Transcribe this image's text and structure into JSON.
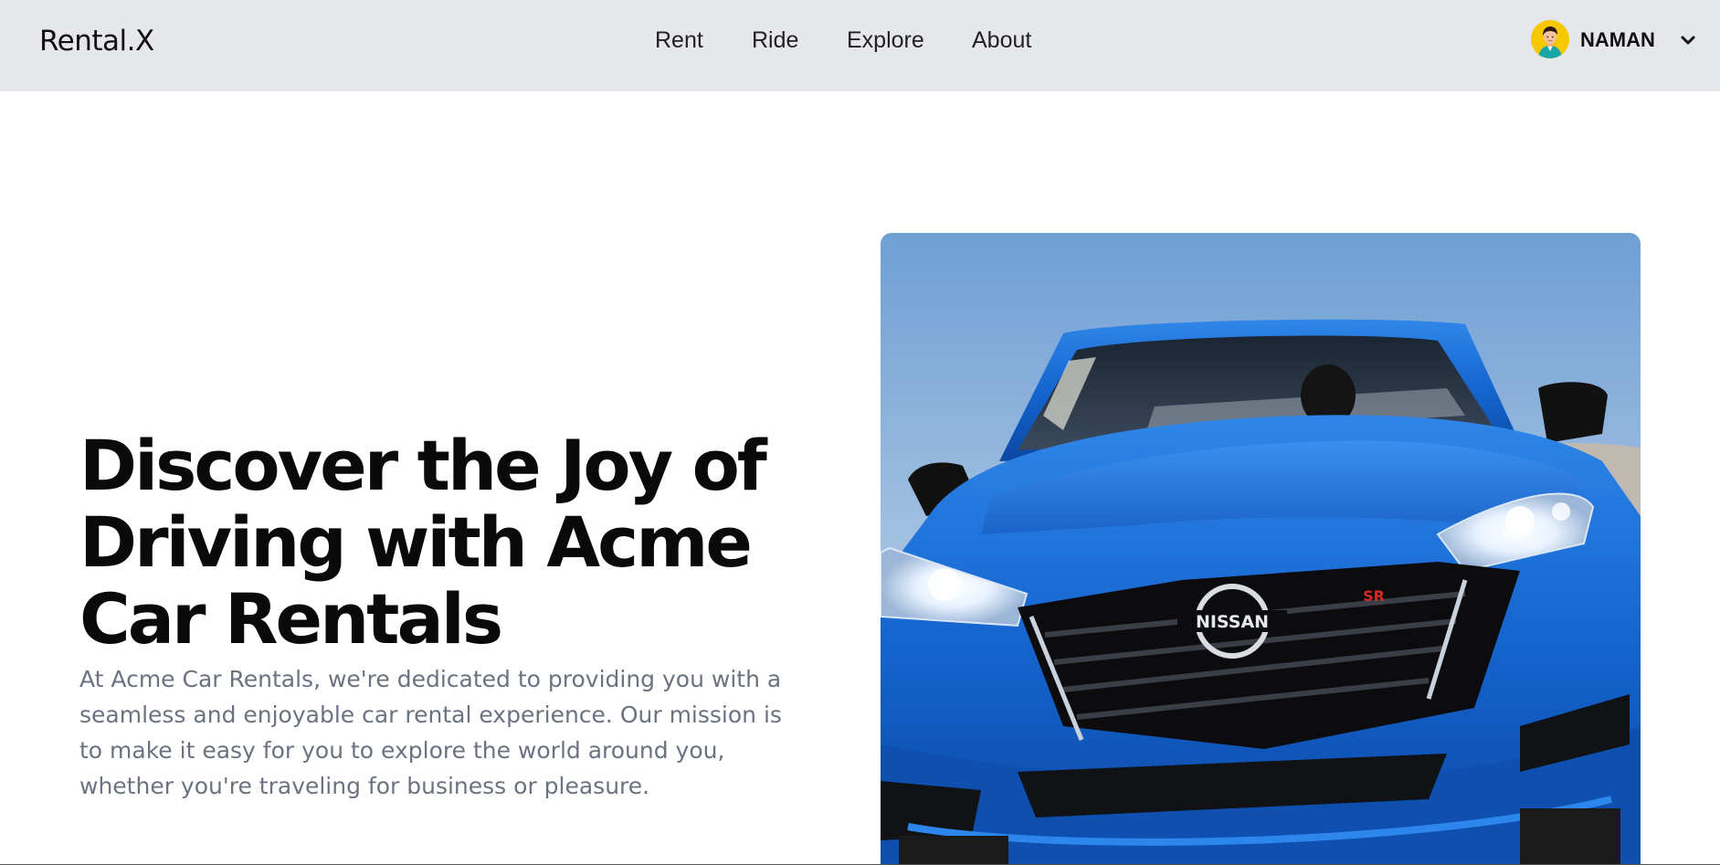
{
  "header": {
    "brand": "Rental.X",
    "nav": [
      {
        "label": "Rent"
      },
      {
        "label": "Ride"
      },
      {
        "label": "Explore"
      },
      {
        "label": "About"
      }
    ],
    "user": {
      "name": "NAMAN",
      "avatar_icon": "user-avatar-icon",
      "menu_icon": "chevron-down-icon"
    },
    "background": "#e5e7eb"
  },
  "hero": {
    "title": "Discover the Joy of Driving with Acme Car Rentals",
    "description": "At Acme Car Rentals, we're dedicated to providing you with a seamless and enjoyable car rental experience. Our mission is to make it easy for you to explore the world around you, whether you're traveling for business or pleasure.",
    "image": {
      "subject": "blue-car-photo",
      "badge": "NISSAN",
      "trim_badge": "SR"
    }
  },
  "colors": {
    "text_primary": "#0a0a0a",
    "text_secondary": "#6b7280",
    "car_blue": "#1f6fd6",
    "avatar_bg": "#f7c800"
  }
}
